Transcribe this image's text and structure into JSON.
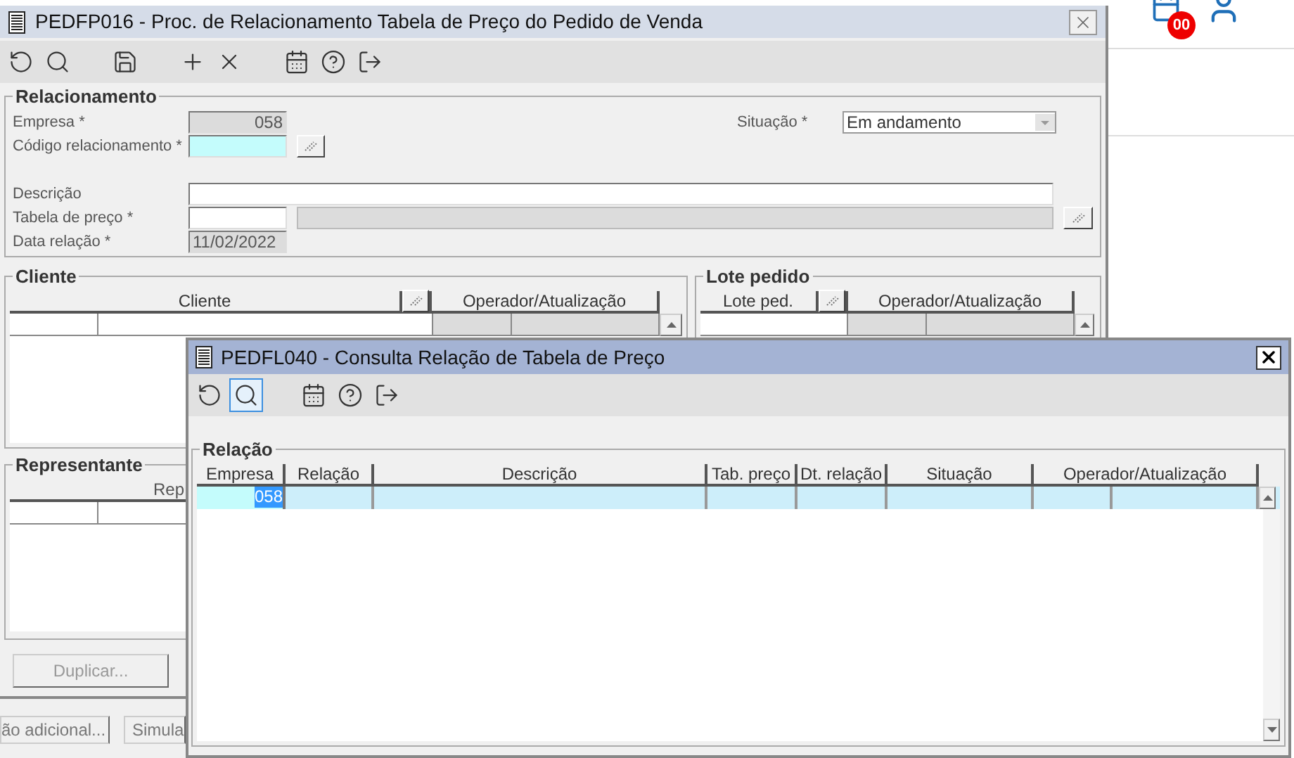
{
  "window": {
    "title": "PEDFP016 - Proc. de Relacionamento Tabela de Preço do Pedido de Venda",
    "toolbar": [
      [
        {
          "kind": "undo",
          "selected": false
        },
        {
          "kind": "search",
          "selected": false
        }
      ],
      [
        {
          "kind": "save",
          "selected": false
        }
      ],
      [
        {
          "kind": "add",
          "selected": false
        },
        {
          "kind": "delete",
          "selected": false
        }
      ],
      [
        {
          "kind": "calendar",
          "selected": false
        },
        {
          "kind": "help",
          "selected": false
        },
        {
          "kind": "exit",
          "selected": false
        }
      ]
    ],
    "relacionamento": {
      "title": "Relacionamento",
      "empresa": {
        "label": "Empresa *",
        "value": "058",
        "kind": "readonly"
      },
      "codigo": {
        "label": "Código relacionamento *",
        "kind": "required"
      },
      "situacao": {
        "label": "Situação *",
        "value": "Em andamento"
      },
      "descricao": {
        "label": "Descrição"
      },
      "tabela": {
        "label": "Tabela de preço *"
      },
      "data": {
        "label": "Data relação *",
        "value": "11/02/2022",
        "kind": "readonly"
      }
    },
    "cliente": {
      "title": "Cliente",
      "columns": [
        "Cliente",
        "Operador/Atualização"
      ]
    },
    "lote": {
      "title": "Lote pedido",
      "columns": [
        "Lote ped.",
        "Operador/Atualização"
      ]
    },
    "representante": {
      "title": "Representante",
      "column": "Rep"
    },
    "duplicate_button": {
      "label": "Duplicar...",
      "disabled": true
    },
    "bottom_buttons": [
      "ão adicional...",
      "Simula"
    ]
  },
  "dialog": {
    "title": "PEDFL040 - Consulta Relação de Tabela de Preço",
    "toolbar": [
      [
        {
          "kind": "undo",
          "selected": false
        },
        {
          "kind": "search",
          "selected": true
        }
      ],
      [
        {
          "kind": "calendar",
          "selected": false
        },
        {
          "kind": "help",
          "selected": false
        },
        {
          "kind": "exit",
          "selected": false
        }
      ]
    ],
    "group": "Relação",
    "columns": [
      "Empresa",
      "Relação",
      "Descrição",
      "Tab. preço",
      "Dt. relação",
      "Situação",
      "Operador/Atualização"
    ],
    "rows": [
      {
        "selected": true,
        "empresa": "058"
      }
    ]
  },
  "notification_badge": "00"
}
